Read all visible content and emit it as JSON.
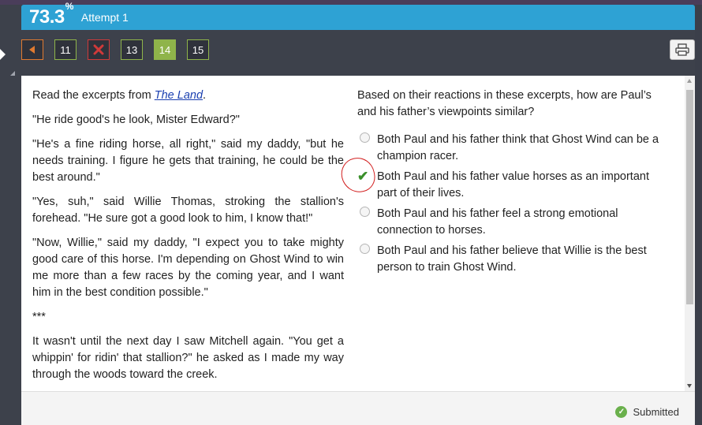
{
  "header": {
    "score": "73.3",
    "score_unit": "%",
    "attempt": "Attempt 1"
  },
  "nav": {
    "back_icon": "triangle-left-icon",
    "buttons": [
      {
        "label": "11",
        "state": "answered"
      },
      {
        "label": "",
        "state": "wrong",
        "icon": "x-mark-icon"
      },
      {
        "label": "13",
        "state": "answered"
      },
      {
        "label": "14",
        "state": "current"
      },
      {
        "label": "15",
        "state": "answered"
      }
    ],
    "print_icon": "printer-icon"
  },
  "passage": {
    "intro_prefix": "Read the excerpts from ",
    "intro_title": "The Land",
    "intro_suffix": ".",
    "paragraphs": [
      "\"He ride good's he look, Mister Edward?\"",
      "\"He's a fine riding horse, all right,\" said my daddy, \"but he needs training. I figure he gets that training, he could be the best around.\"",
      "\"Yes, suh,\" said Willie Thomas, stroking the stallion's forehead. \"He sure got a good look to him, I know that!\"",
      "\"Now, Willie,\" said my daddy, \"I expect you to take mighty good care of this horse. I'm depending on Ghost Wind to win me more than a few races by the coming year, and I want him in the best condition possible.\"",
      "***",
      "It wasn't until the next day I saw Mitchell again. \"You get a whippin' for ridin' that stallion?\" he asked as I made my way through the woods toward the creek."
    ]
  },
  "question": {
    "text": "Based on their reactions in these excerpts, how are Paul’s and his father’s viewpoints similar?",
    "options": [
      {
        "label": "Both Paul and his father think that Ghost Wind can be a champion racer.",
        "selected": false
      },
      {
        "label": "Both Paul and his father value horses as an important part of their lives.",
        "selected": true
      },
      {
        "label": "Both Paul and his father feel a strong emotional connection to horses.",
        "selected": false
      },
      {
        "label": "Both Paul and his father believe that Willie is the best person to train Ghost Wind.",
        "selected": false
      }
    ],
    "check_glyph": "✔"
  },
  "footer": {
    "status": "Submitted",
    "status_icon": "check-circle-icon"
  },
  "colors": {
    "accent": "#2ea2d4",
    "answered": "#8fb44a",
    "wrong": "#d03a3a",
    "back": "#e07a30",
    "correct": "#3a8f2a",
    "annotation": "#d21f1f"
  }
}
